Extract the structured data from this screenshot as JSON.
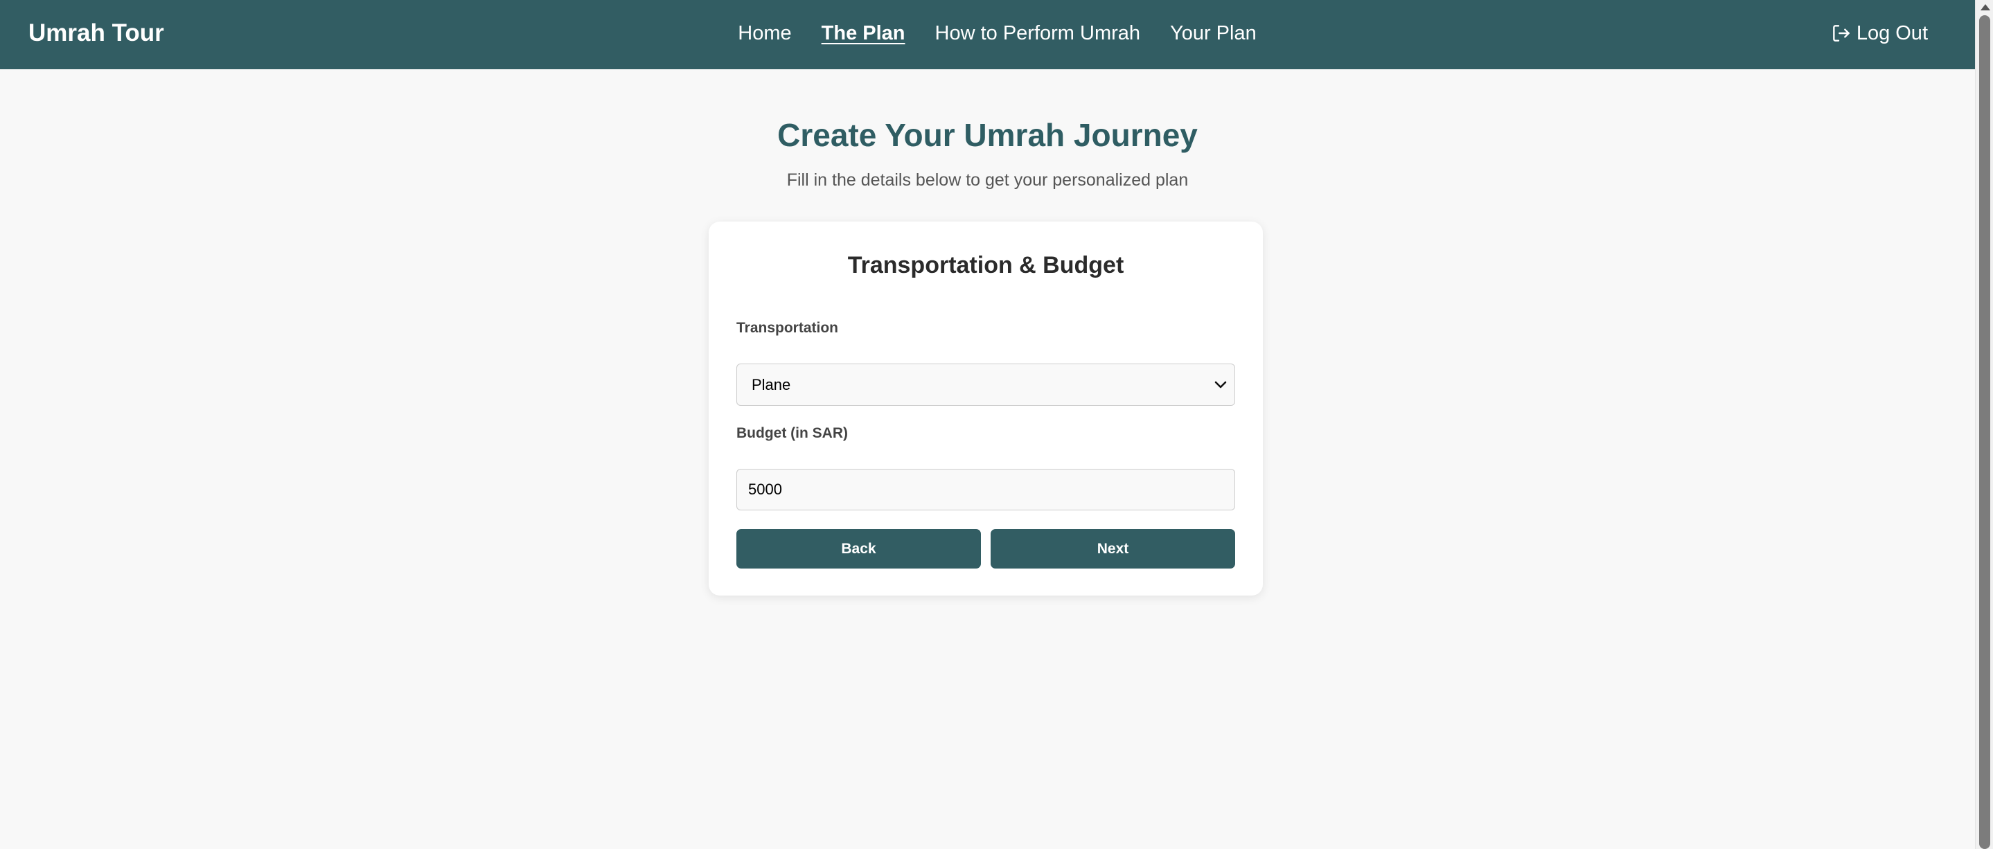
{
  "navbar": {
    "brand": "Umrah Tour",
    "links": [
      {
        "label": "Home",
        "active": false
      },
      {
        "label": "The Plan",
        "active": true
      },
      {
        "label": "How to Perform Umrah",
        "active": false
      },
      {
        "label": "Your Plan",
        "active": false
      }
    ],
    "logout_label": "Log Out",
    "logout_icon": "log-out-icon"
  },
  "main": {
    "title": "Create Your Umrah Journey",
    "subtitle": "Fill in the details below to get your personalized plan"
  },
  "form": {
    "step_title": "Transportation & Budget",
    "transportation": {
      "label": "Transportation",
      "selected": "Plane"
    },
    "budget": {
      "label": "Budget (in SAR)",
      "value": "5000"
    },
    "back_label": "Back",
    "next_label": "Next"
  },
  "colors": {
    "primary": "#325d63",
    "heading": "#2f5d63",
    "background": "#f8f8f8"
  }
}
